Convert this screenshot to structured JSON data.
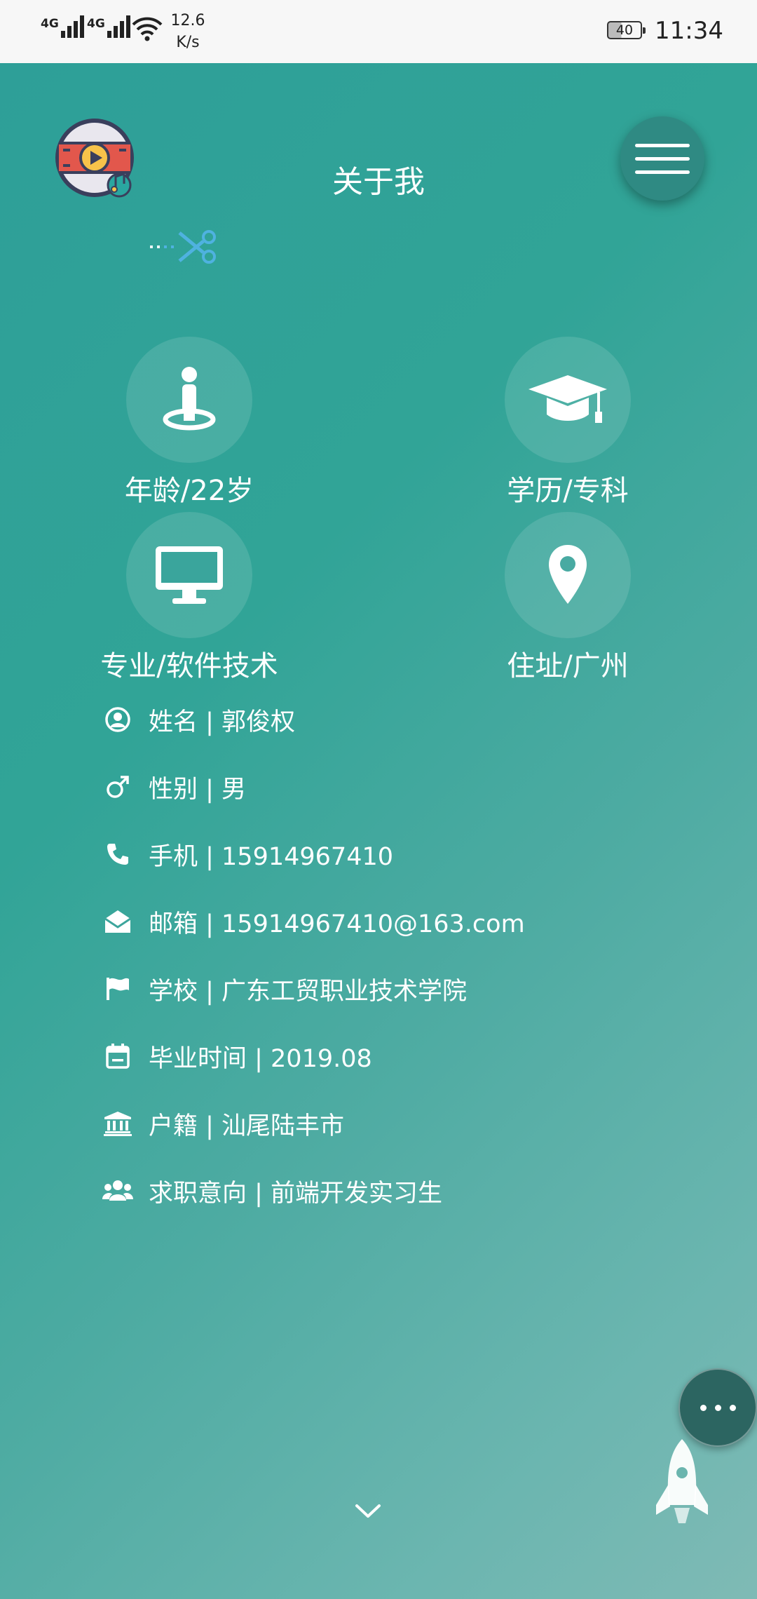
{
  "status_bar": {
    "network1": "4G",
    "network2": "4G",
    "speed_value": "12.6",
    "speed_unit": "K/s",
    "battery": "40",
    "time": "11:34"
  },
  "header": {
    "title": "关于我",
    "logo_icon": "video-music-logo-icon",
    "menu_icon": "hamburger-menu-icon"
  },
  "summary": [
    {
      "label": "年龄/22岁",
      "icon": "person-pin-icon"
    },
    {
      "label": "学历/专科",
      "icon": "graduation-cap-icon"
    },
    {
      "label": "专业/软件技术",
      "icon": "desktop-monitor-icon"
    },
    {
      "label": "住址/广州",
      "icon": "map-marker-icon"
    }
  ],
  "details": [
    {
      "text": "姓名 | 郭俊权",
      "icon": "user-circle-icon"
    },
    {
      "text": "性别 | 男",
      "icon": "male-icon"
    },
    {
      "text": "手机 | 15914967410",
      "icon": "phone-icon"
    },
    {
      "text": "邮箱 | 15914967410@163.com",
      "icon": "envelope-open-icon"
    },
    {
      "text": "学校 | 广东工贸职业技术学院",
      "icon": "flag-icon"
    },
    {
      "text": "毕业时间 | 2019.08",
      "icon": "calendar-icon"
    },
    {
      "text": "户籍 | 汕尾陆丰市",
      "icon": "institution-icon"
    },
    {
      "text": "求职意向 | 前端开发实习生",
      "icon": "users-icon"
    }
  ],
  "colors": {
    "bg_start": "#2e9f98",
    "bg_end": "#7fbab5",
    "accent": "#4fb2e0",
    "fab": "#2c6561"
  }
}
